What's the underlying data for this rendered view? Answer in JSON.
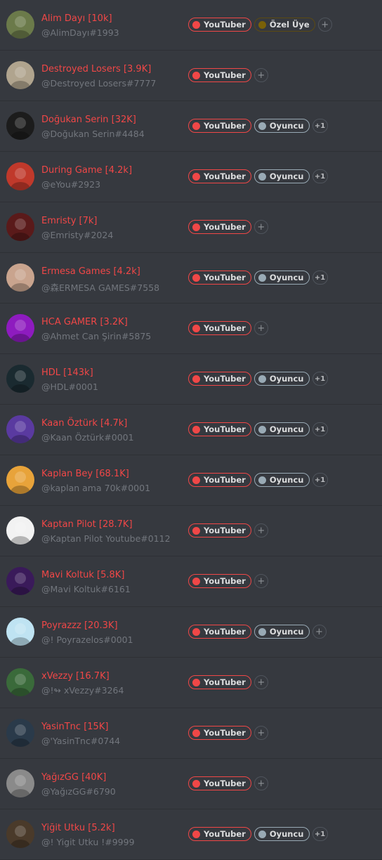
{
  "roles": {
    "youtuber": "YouTuber",
    "oyuncu": "Oyuncu",
    "ozel_uye": "Özel Üye"
  },
  "colors": {
    "background": "#36393f",
    "name": "#f04747",
    "youtuber": "#f04747",
    "oyuncu": "#99aab5",
    "ozel_uye": "#7a6108"
  },
  "members": [
    {
      "name": "Alim Dayı [10k]",
      "tag": "@AlimDayı#1993",
      "roles": [
        "youtuber",
        "ozel_uye"
      ],
      "more": "",
      "avatar_color": "#6b7a4a"
    },
    {
      "name": "Destroyed Losers [3.9K]",
      "tag": "@Destroyed Losers#7777",
      "roles": [
        "youtuber"
      ],
      "more": "",
      "avatar_color": "#b0a48e"
    },
    {
      "name": "Doğukan Serin [32K]",
      "tag": "@Doğukan Serin#4484",
      "roles": [
        "youtuber",
        "oyuncu"
      ],
      "more": "+1",
      "avatar_color": "#1c1c1c"
    },
    {
      "name": "During Game [4.2k]",
      "tag": "@eYou#2923",
      "roles": [
        "youtuber",
        "oyuncu"
      ],
      "more": "+1",
      "avatar_color": "#c0392b"
    },
    {
      "name": "Emristy [7k]",
      "tag": "@Emristy#2024",
      "roles": [
        "youtuber"
      ],
      "more": "",
      "avatar_color": "#5a1a1a"
    },
    {
      "name": "Ermesa Games [4.2k]",
      "tag": "@森ERMESA GAMES#7558",
      "roles": [
        "youtuber",
        "oyuncu"
      ],
      "more": "+1",
      "avatar_color": "#c9a48e"
    },
    {
      "name": "HCA GAMER [3.2K]",
      "tag": "@Ahmet Can Şirin#5875",
      "roles": [
        "youtuber"
      ],
      "more": "",
      "avatar_color": "#8e1bbf"
    },
    {
      "name": "HDL [143k]",
      "tag": "@HDL#0001",
      "roles": [
        "youtuber",
        "oyuncu"
      ],
      "more": "+1",
      "avatar_color": "#1a2a30"
    },
    {
      "name": "Kaan Öztürk [4.7k]",
      "tag": "@Kaan Öztürk#0001",
      "roles": [
        "youtuber",
        "oyuncu"
      ],
      "more": "+1",
      "avatar_color": "#5a3aa0"
    },
    {
      "name": "Kaplan Bey [68.1K]",
      "tag": "@kaplan ama 70k#0001",
      "roles": [
        "youtuber",
        "oyuncu"
      ],
      "more": "+1",
      "avatar_color": "#e8a33a"
    },
    {
      "name": "Kaptan Pilot [28.7K]",
      "tag": "@Kaptan Pilot Youtube#0112",
      "roles": [
        "youtuber"
      ],
      "more": "",
      "avatar_color": "#f2f2f2"
    },
    {
      "name": "Mavi Koltuk [5.8K]",
      "tag": "@Mavi Koltuk#6161",
      "roles": [
        "youtuber"
      ],
      "more": "",
      "avatar_color": "#3a1a5a"
    },
    {
      "name": "Poyrazzz [20.3K]",
      "tag": "@! Poyrazelos#0001",
      "roles": [
        "youtuber",
        "oyuncu"
      ],
      "more": "",
      "avatar_color": "#bfe3f2"
    },
    {
      "name": "xVezzy [16.7K]",
      "tag": "@!↬ xVezzy#3264",
      "roles": [
        "youtuber"
      ],
      "more": "",
      "avatar_color": "#3a6a3a"
    },
    {
      "name": "YasinTnc [15K]",
      "tag": "@'YasinTnc#0744",
      "roles": [
        "youtuber"
      ],
      "more": "",
      "avatar_color": "#2a3a4a"
    },
    {
      "name": "YağızGG [40K]",
      "tag": "@YağızGG#6790",
      "roles": [
        "youtuber"
      ],
      "more": "",
      "avatar_color": "#8a8a8a"
    },
    {
      "name": "Yiğit Utku [5.2k]",
      "tag": "@! Yigit Utku !#9999",
      "roles": [
        "youtuber",
        "oyuncu"
      ],
      "more": "+1",
      "avatar_color": "#4a3a2a"
    }
  ]
}
